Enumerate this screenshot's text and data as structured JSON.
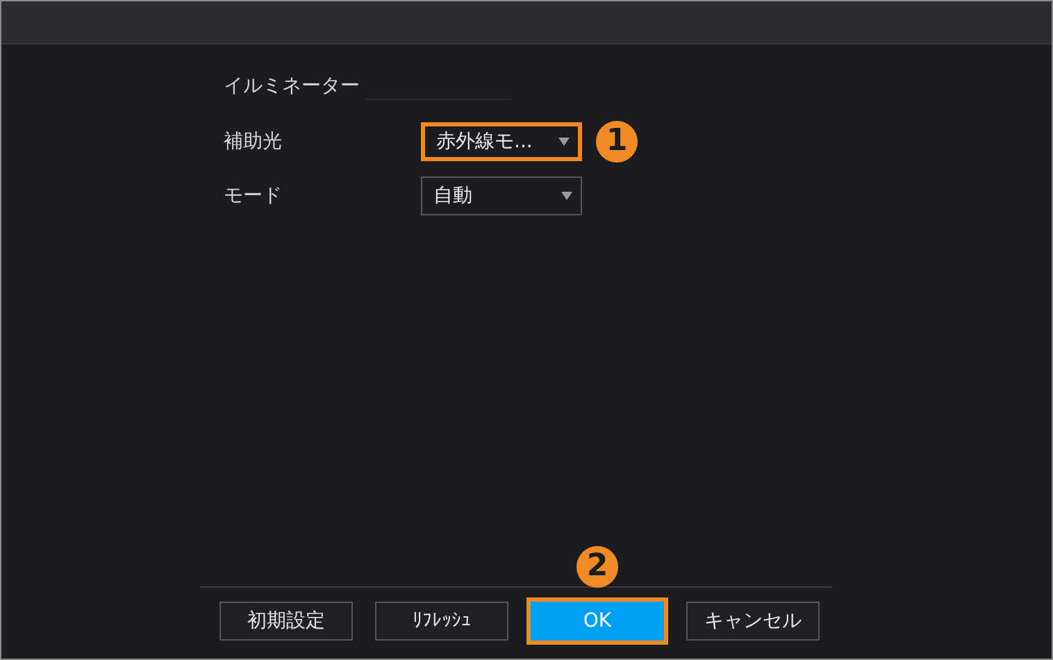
{
  "section": {
    "title": "イルミネーター"
  },
  "fields": [
    {
      "label": "補助光",
      "value": "赤外線モ...",
      "highlighted": true,
      "callout": "1"
    },
    {
      "label": "モード",
      "value": "自動",
      "highlighted": false
    }
  ],
  "buttons": [
    {
      "label": "初期設定",
      "kind": "normal",
      "highlighted": false
    },
    {
      "label": "ﾘﾌﾚｯｼｭ",
      "kind": "normal",
      "highlighted": false
    },
    {
      "label": "OK",
      "kind": "primary",
      "highlighted": true,
      "callout": "2"
    },
    {
      "label": "キャンセル",
      "kind": "normal",
      "highlighted": false
    }
  ]
}
